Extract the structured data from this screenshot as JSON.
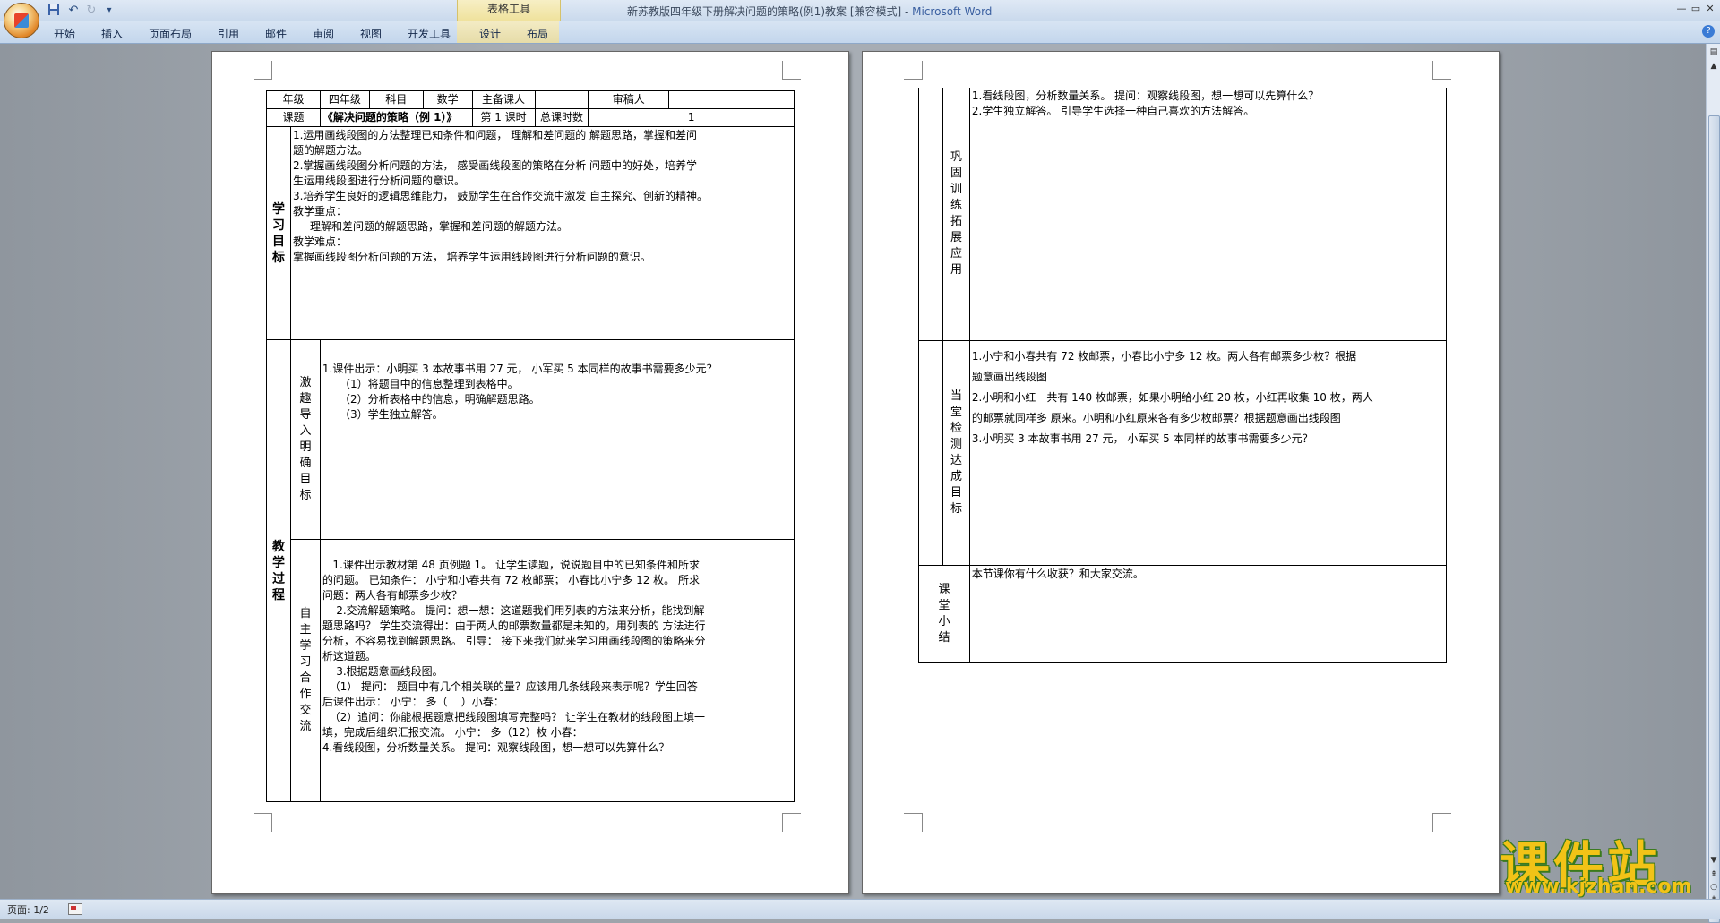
{
  "titlebar": {
    "document_title": "新苏教版四年级下册解决问题的策略(例1)教案 [兼容模式] - ",
    "app_name": "Microsoft Word",
    "context_group": "表格工具",
    "qat_save": "save-icon",
    "qat_undo": "↶",
    "qat_redo": "↻",
    "qat_more": "▾",
    "min": "—",
    "max": "▭",
    "close": "✕"
  },
  "ribbon": {
    "tabs": [
      "开始",
      "插入",
      "页面布局",
      "引用",
      "邮件",
      "审阅",
      "视图",
      "开发工具",
      "设计",
      "布局"
    ]
  },
  "page1": {
    "header_row1": [
      "年级",
      "四年级",
      "科目",
      "数学",
      "主备课人",
      "",
      "审稿人",
      ""
    ],
    "header_row2": {
      "label": "课题",
      "title": "《解决问题的策略（例 1）》",
      "lesson_label": "第 1 课时",
      "total_label": "总课时数",
      "total_value": "1"
    },
    "goals_label": "学习目标",
    "goals": [
      "1.运用画线段图的方法整理已知条件和问题， 理解和差问题的 解题思路，掌握和差问",
      "题的解题方法。",
      "2.掌握画线段图分析问题的方法， 感受画线段图的策略在分析 问题中的好处，培养学",
      "生运用线段图进行分析问题的意识。",
      "3.培养学生良好的逻辑思维能力， 鼓励学生在合作交流中激发 自主探究、创新的精神。",
      "教学重点：",
      "     理解和差问题的解题思路，掌握和差问题的解题方法。",
      "教学难点：",
      "掌握画线段图分析问题的方法， 培养学生运用线段图进行分析问题的意识。"
    ],
    "process_label": "教学过程",
    "stage1_label": "激趣导入 明确目标",
    "stage1_lines": [
      "1.课件出示：小明买 3 本故事书用 27 元， 小军买 5 本同样的故事书需要多少元？",
      "     （1）将题目中的信息整理到表格中。",
      "     （2）分析表格中的信息，明确解题思路。",
      "     （3）学生独立解答。"
    ],
    "stage2_label": "自主学习 合作交流",
    "stage2_lines": [
      "   1.课件出示教材第 48 页例题 1。 让学生读题，说说题目中的已知条件和所求",
      "的问题。 已知条件： 小宁和小春共有 72 枚邮票； 小春比小宁多 12 枚。 所求",
      "问题：两人各有邮票多少枚？",
      "    2.交流解题策略。 提问：想一想：这道题我们用列表的方法来分析，能找到解",
      "题思路吗？ 学生交流得出：由于两人的邮票数量都是未知的，用列表的 方法进行",
      "分析，不容易找到解题思路。 引导： 接下来我们就来学习用画线段图的策略来分",
      "析这道题。",
      "    3.根据题意画线段图。",
      "  （1） 提问： 题目中有几个相关联的量？应该用几条线段来表示呢？学生回答",
      "后课件出示： 小宁： 多（    ）小春：",
      "  （2）追问：你能根据题意把线段图填写完整吗？ 让学生在教材的线段图上填一",
      "填，完成后组织汇报交流。 小宁： 多（12）枚 小春：",
      "4.看线段图，分析数量关系。 提问：观察线段图，想一想可以先算什么？"
    ]
  },
  "page2": {
    "stage3_label": "巩固训练 拓展应用",
    "stage3_lines": [
      "1.看线段图，分析数量关系。 提问：观察线段图，想一想可以先算什么？",
      "2.学生独立解答。 引导学生选择一种自己喜欢的方法解答。"
    ],
    "stage4_label": "当堂检测 达成目标",
    "stage4_lines": [
      "1.小宁和小春共有 72 枚邮票，小春比小宁多 12 枚。两人各有邮票多少枚？根据",
      "题意画出线段图",
      "2.小明和小红一共有 140 枚邮票，如果小明给小红 20 枚，小红再收集 10 枚，两人",
      "的邮票就同样多 原来。小明和小红原来各有多少枚邮票？根据题意画出线段图",
      "3.小明买 3 本故事书用 27 元， 小军买 5 本同样的故事书需要多少元？"
    ],
    "summary_label": "课堂小结",
    "summary_text": "本节课你有什么收获？和大家交流。"
  },
  "statusbar": {
    "page_indicator": "页面: 1/2"
  },
  "watermark": {
    "title": "课件站",
    "url": "www.kjzhan.com"
  }
}
